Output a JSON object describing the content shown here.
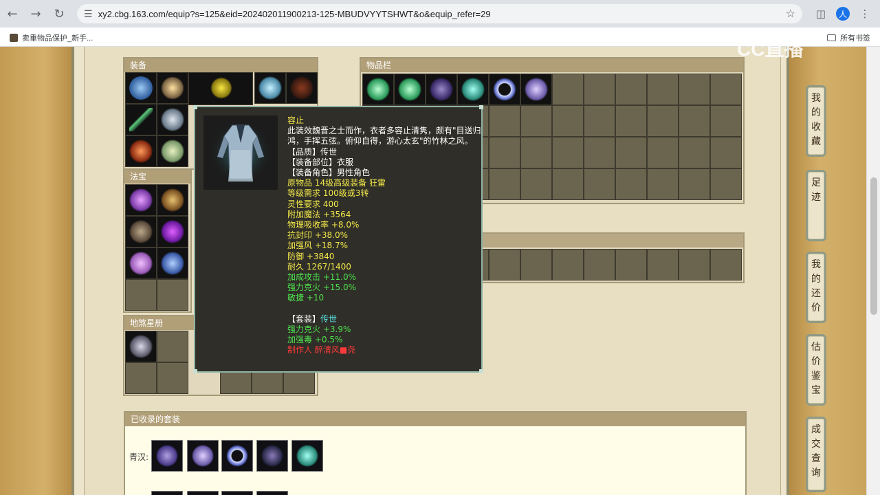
{
  "browser": {
    "url": "xy2.cbg.163.com/equip?s=125&eid=202402011900213-125-MBUDVYYTSHWT&o&equip_refer=29",
    "bookmark_item": "卖重物品保护_新手...",
    "all_bookmarks": "所有书签",
    "profile_initial": "人"
  },
  "watermark": "CC直播",
  "panels": {
    "equipment": "装备",
    "treasure": "法宝",
    "star_book": "地煞星册",
    "inventory": "物品栏",
    "collected_sets": "已收录的套装"
  },
  "side_tabs": [
    {
      "label": "我的收藏"
    },
    {
      "label": "足迹"
    },
    {
      "label": "我的还价"
    },
    {
      "label": "估价鉴宝"
    },
    {
      "label": "成交查询"
    }
  ],
  "tooltip": {
    "name": "容止",
    "desc": "此装效魏晋之士而作，衣者多容止清隽，颇有\"目送归鸿，手挥五弦。俯仰自得，游心太玄\"的竹林之风。",
    "quality": "【品质】传世",
    "slot": "【装备部位】衣服",
    "role": "【装备角色】男性角色",
    "origin": "原物品 14级高级装备 狂雷",
    "level_req": "等级需求 100级或3转",
    "spirit_req": "灵性要求 400",
    "magic": "附加魔法 +3564",
    "phys_absorb": "物理吸收率 +8.0%",
    "seal_resist": "抗封印 +38.0%",
    "wind": "加强风 +18.7%",
    "defense": "防御 +3840",
    "durability": "耐久 1267/1400",
    "attack_bonus": "加成攻击 +11.0%",
    "fire_break": "强力克火 +15.0%",
    "agility": "敏捷 +10",
    "set_label": "【套装】",
    "set_name": "传世",
    "set_fire": "强力克火 +3.9%",
    "set_poison": "加强毒 +0.5%",
    "maker": "制作人 醉清风■尧"
  },
  "sets": {
    "label": "青汉:"
  }
}
